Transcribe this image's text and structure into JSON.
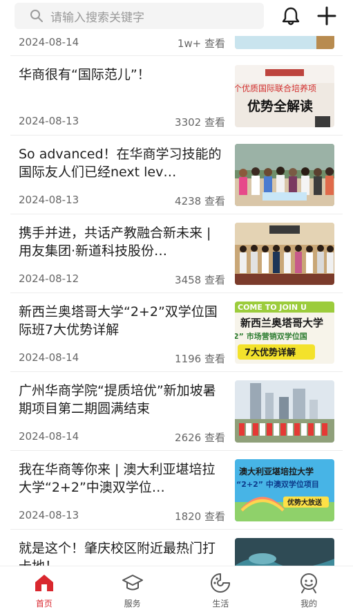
{
  "search": {
    "placeholder": "请输入搜索关键字"
  },
  "icons": {
    "search": "search-icon",
    "bell": "bell-icon",
    "add": "plus-icon"
  },
  "colors": {
    "accent": "#d9272e",
    "tab_inactive": "#555555"
  },
  "feed": [
    {
      "title": "",
      "date": "2024-08-14",
      "views": "1w+ 查看"
    },
    {
      "title": "华商很有“国际范儿”！",
      "date": "2024-08-13",
      "views": "3302 查看",
      "thumb_text": [
        "个优质国际联合培养项",
        "优势全解读"
      ]
    },
    {
      "title": "So advanced！在华商学习技能的国际友人们已经next lev…",
      "date": "2024-08-13",
      "views": "4238 查看"
    },
    {
      "title": "携手并进，共话产教融合新未来 | 用友集团·新道科技股份…",
      "date": "2024-08-12",
      "views": "3458 查看"
    },
    {
      "title": "新西兰奥塔哥大学“2+2”双学位国际班7大优势详解",
      "date": "2024-08-14",
      "views": "1196 查看",
      "thumb_text": [
        "COME TO JOIN U",
        "新西兰奥塔哥大学",
        "2” 市场营销双学位国",
        "7大优势详解"
      ]
    },
    {
      "title": "广州华商学院“提质培优”新加坡暑期项目第二期圆满结束",
      "date": "2024-08-14",
      "views": "2626 查看"
    },
    {
      "title": "我在华商等你来 | 澳大利亚堪培拉大学“2+2”中澳双学位…",
      "date": "2024-08-13",
      "views": "1820 查看",
      "thumb_text": [
        "澳大利亚堪培拉大学",
        "“2+2” 中澳双学位项目",
        "优势大放送"
      ]
    },
    {
      "title": "就是这个！肇庆校区附近最热门打卡地！",
      "date": "",
      "views": ""
    }
  ],
  "tabs": [
    {
      "label": "首页",
      "active": true
    },
    {
      "label": "服务",
      "active": false
    },
    {
      "label": "生活",
      "active": false
    },
    {
      "label": "我的",
      "active": false
    }
  ]
}
